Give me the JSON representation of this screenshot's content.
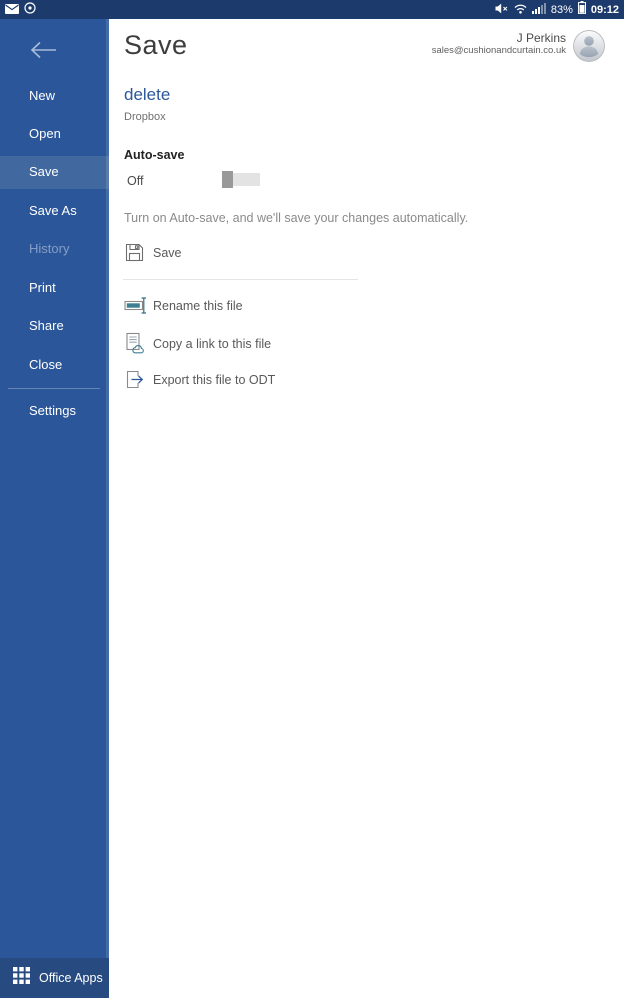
{
  "colors": {
    "status_bar": "#1c3a6b",
    "sidebar": "#2b579a",
    "sidebar_selected": "#41699f",
    "office_apps_bar": "#274b80",
    "accent_blue": "#2b579a",
    "icon_teal": "#3d7f92",
    "toggle_track": "#e3e3e3",
    "toggle_thumb": "#999999"
  },
  "status_bar": {
    "time": "09:12",
    "battery_percent": "83%",
    "left_icons": [
      "mail-icon",
      "status-circle-icon"
    ],
    "right_icons": [
      "mute-icon",
      "wifi-icon",
      "signal-icon",
      "battery-icon"
    ]
  },
  "sidebar": {
    "back_icon": "back-arrow-icon",
    "items": [
      {
        "label": "New",
        "state": "normal"
      },
      {
        "label": "Open",
        "state": "normal"
      },
      {
        "label": "Save",
        "state": "selected"
      },
      {
        "label": "Save As",
        "state": "normal"
      },
      {
        "label": "History",
        "state": "disabled"
      },
      {
        "label": "Print",
        "state": "normal"
      },
      {
        "label": "Share",
        "state": "normal"
      },
      {
        "label": "Close",
        "state": "normal"
      }
    ],
    "settings_label": "Settings",
    "office_apps_label": "Office Apps",
    "office_apps_icon": "apps-grid-icon"
  },
  "header": {
    "title": "Save",
    "user_name": "J Perkins",
    "user_email": "sales@cushionandcurtain.co.uk",
    "avatar_icon": "person-avatar-icon"
  },
  "file": {
    "name": "delete",
    "location": "Dropbox"
  },
  "autosave": {
    "heading": "Auto-save",
    "state_label": "Off",
    "enabled": false,
    "description": "Turn on Auto-save, and we'll save your changes automatically."
  },
  "actions": {
    "save": {
      "label": "Save",
      "icon": "floppy-save-icon"
    },
    "rename": {
      "label": "Rename this file",
      "icon": "rename-field-icon"
    },
    "copy_link": {
      "label": "Copy a link to this file",
      "icon": "document-cloud-icon"
    },
    "export_odt": {
      "label": "Export this file to ODT",
      "icon": "export-document-icon"
    }
  }
}
